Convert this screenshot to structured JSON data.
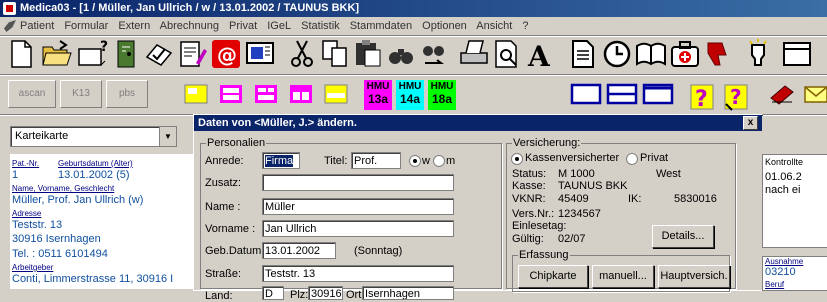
{
  "window": {
    "title": "Medica03 - [1 / Müller, Jan Ullrich / w / 13.01.2002 / TAUNUS BKK]"
  },
  "menu": [
    "Patient",
    "Formular",
    "Extern",
    "Abrechnung",
    "Privat",
    "IGeL",
    "Statistik",
    "Stammdaten",
    "Optionen",
    "Ansicht",
    "?"
  ],
  "toolbar2": {
    "gray_buttons": [
      "ascan",
      "K13",
      "pbs"
    ],
    "hmu": [
      {
        "top": "HMU",
        "bottom": "13a"
      },
      {
        "top": "HMU",
        "bottom": "14a"
      },
      {
        "top": "HMU",
        "bottom": "18a"
      }
    ]
  },
  "left": {
    "combo_value": "Karteikarte",
    "labels": {
      "patnr": "Pat.-Nr.",
      "gebdat": "Geburtsdatum (Alter)",
      "name": "Name, Vorname, Geschlecht",
      "adresse": "Adresse",
      "arbeitgeber": "Arbeitgeber"
    },
    "values": {
      "patnr": "1",
      "gebdat": "13.01.2002 (5)",
      "name": "Müller, Prof. Jan Ullrich (w)",
      "street": "Teststr. 13",
      "city": "30916 Isernhagen",
      "tel": "Tel. : 0511 6101494",
      "arbeitgeber": "Conti, Limmerstrasse 11, 30916 I"
    }
  },
  "dialog": {
    "title": "Daten von <Müller, J.> ändern.",
    "close": "x",
    "personalien": {
      "legend": "Personalien",
      "anrede_label": "Anrede:",
      "anrede_value": "Firma",
      "titel_label": "Titel:",
      "titel_value": "Prof.",
      "w_label": "w",
      "m_label": "m",
      "zusatz_label": "Zusatz:",
      "zusatz_value": "",
      "name_label": "Name :",
      "name_value": "Müller",
      "vorname_label": "Vorname :",
      "vorname_value": "Jan Ullrich",
      "gebdat_label": "Geb.Datum:",
      "gebdat_value": "13.01.2002",
      "weekday": "(Sonntag)",
      "strasse_label": "Straße:",
      "strasse_value": "Teststr. 13",
      "land_label": "Land:",
      "land_value": "D",
      "plz_label": "Plz:",
      "plz_value": "30916",
      "ort_label": "Ort:",
      "ort_value": "Isernhagen"
    },
    "versicherung": {
      "legend": "Versicherung:",
      "kasse_radio": "Kassenversicherter",
      "privat_radio": "Privat",
      "status_label": "Status:",
      "status_value": "M 1000",
      "region": "West",
      "kasse_label": "Kasse:",
      "kasse_value": "TAUNUS BKK",
      "vknr_label": "VKNR:",
      "vknr_value": "45409",
      "ik_label": "IK:",
      "ik_value": "5830016",
      "versnr_label": "Vers.Nr.:",
      "versnr_value": "1234567",
      "einlesetag_label": "Einlesetag:",
      "gueltig_label": "Gültig:",
      "gueltig_value": "02/07",
      "details_button": "Details..."
    },
    "erfassung": {
      "legend": "Erfassung",
      "chipkarte": "Chipkarte",
      "manuell": "manuell...",
      "hauptversich": "Hauptversich."
    }
  },
  "right": {
    "kontrolle_label": "Kontrollte",
    "kontrolle_date": "01.06.2",
    "kontrolle_text": "nach ei",
    "ausnahme_label": "Ausnahme",
    "ausnahme_value": "03210",
    "beruf_label": "Beruf"
  }
}
